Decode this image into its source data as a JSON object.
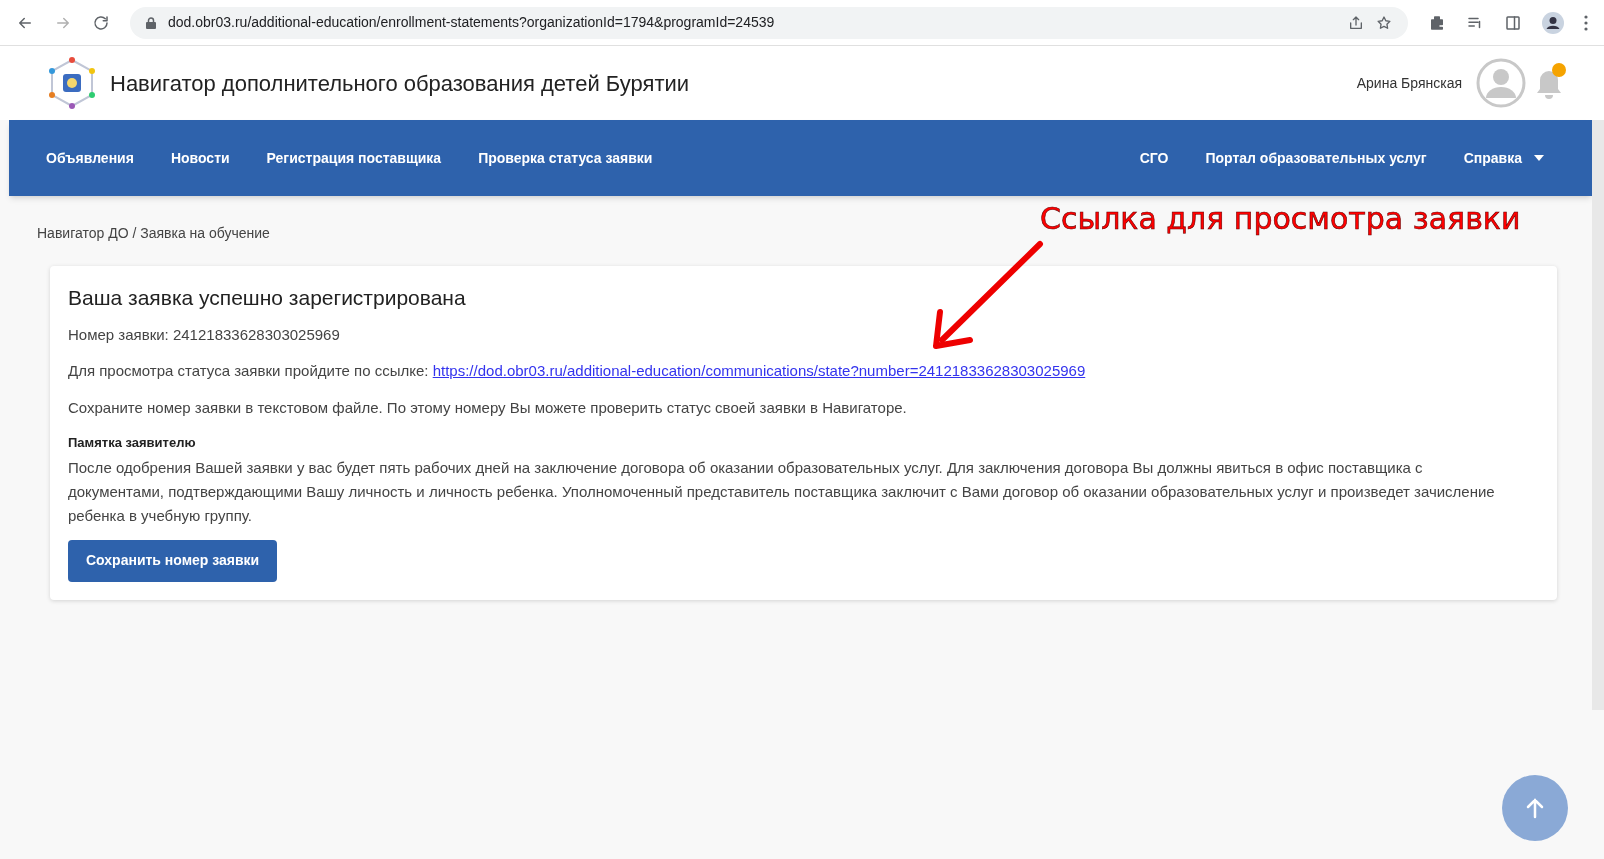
{
  "browser": {
    "url": "dod.obr03.ru/additional-education/enrollment-statements?organizationId=1794&programId=24539"
  },
  "header": {
    "title": "Навигатор дополнительного образования детей Бурятии",
    "user": "Арина Брянская",
    "notification_dot": true
  },
  "nav": {
    "left": [
      {
        "label": "Объявления",
        "kind": "link"
      },
      {
        "label": "Новости",
        "kind": "link"
      },
      {
        "label": "Регистрация поставщика",
        "kind": "link"
      },
      {
        "label": "Проверка статуса заявки",
        "kind": "link"
      }
    ],
    "right": [
      {
        "label": "СГО",
        "kind": "link"
      },
      {
        "label": "Портал образовательных услуг",
        "kind": "link"
      },
      {
        "label": "Справка",
        "kind": "menu"
      }
    ]
  },
  "breadcrumb": "Навигатор ДО / Заявка на обучение",
  "annotation": {
    "text": "Ссылка для просмотра заявки"
  },
  "card": {
    "title": "Ваша заявка успешно зарегистрирована",
    "number_line": "Номер заявки: 24121833628303025969",
    "link_prefix": "Для просмотра статуса заявки пройдите по ссылке: ",
    "link": "https://dod.obr03.ru/additional-education/communications/state?number=24121833628303025969",
    "save_hint": "Сохраните номер заявки в текстовом файле. По этому номеру Вы можете проверить статус своей заявки в Навигаторе.",
    "memo_title": "Памятка заявителю",
    "memo_text": "После одобрения Вашей заявки у вас будет пять рабочих дней на заключение договора об оказании образовательных услуг. Для заключения договора Вы должны явиться в офис поставщика с документами, подтверждающими Вашу личность и личность ребенка. Уполномоченный представитель поставщика заключит с Вами договор об оказании образовательных услуг и произведет зачисление ребенка в учебную группу.",
    "button": "Сохранить номер заявки"
  }
}
